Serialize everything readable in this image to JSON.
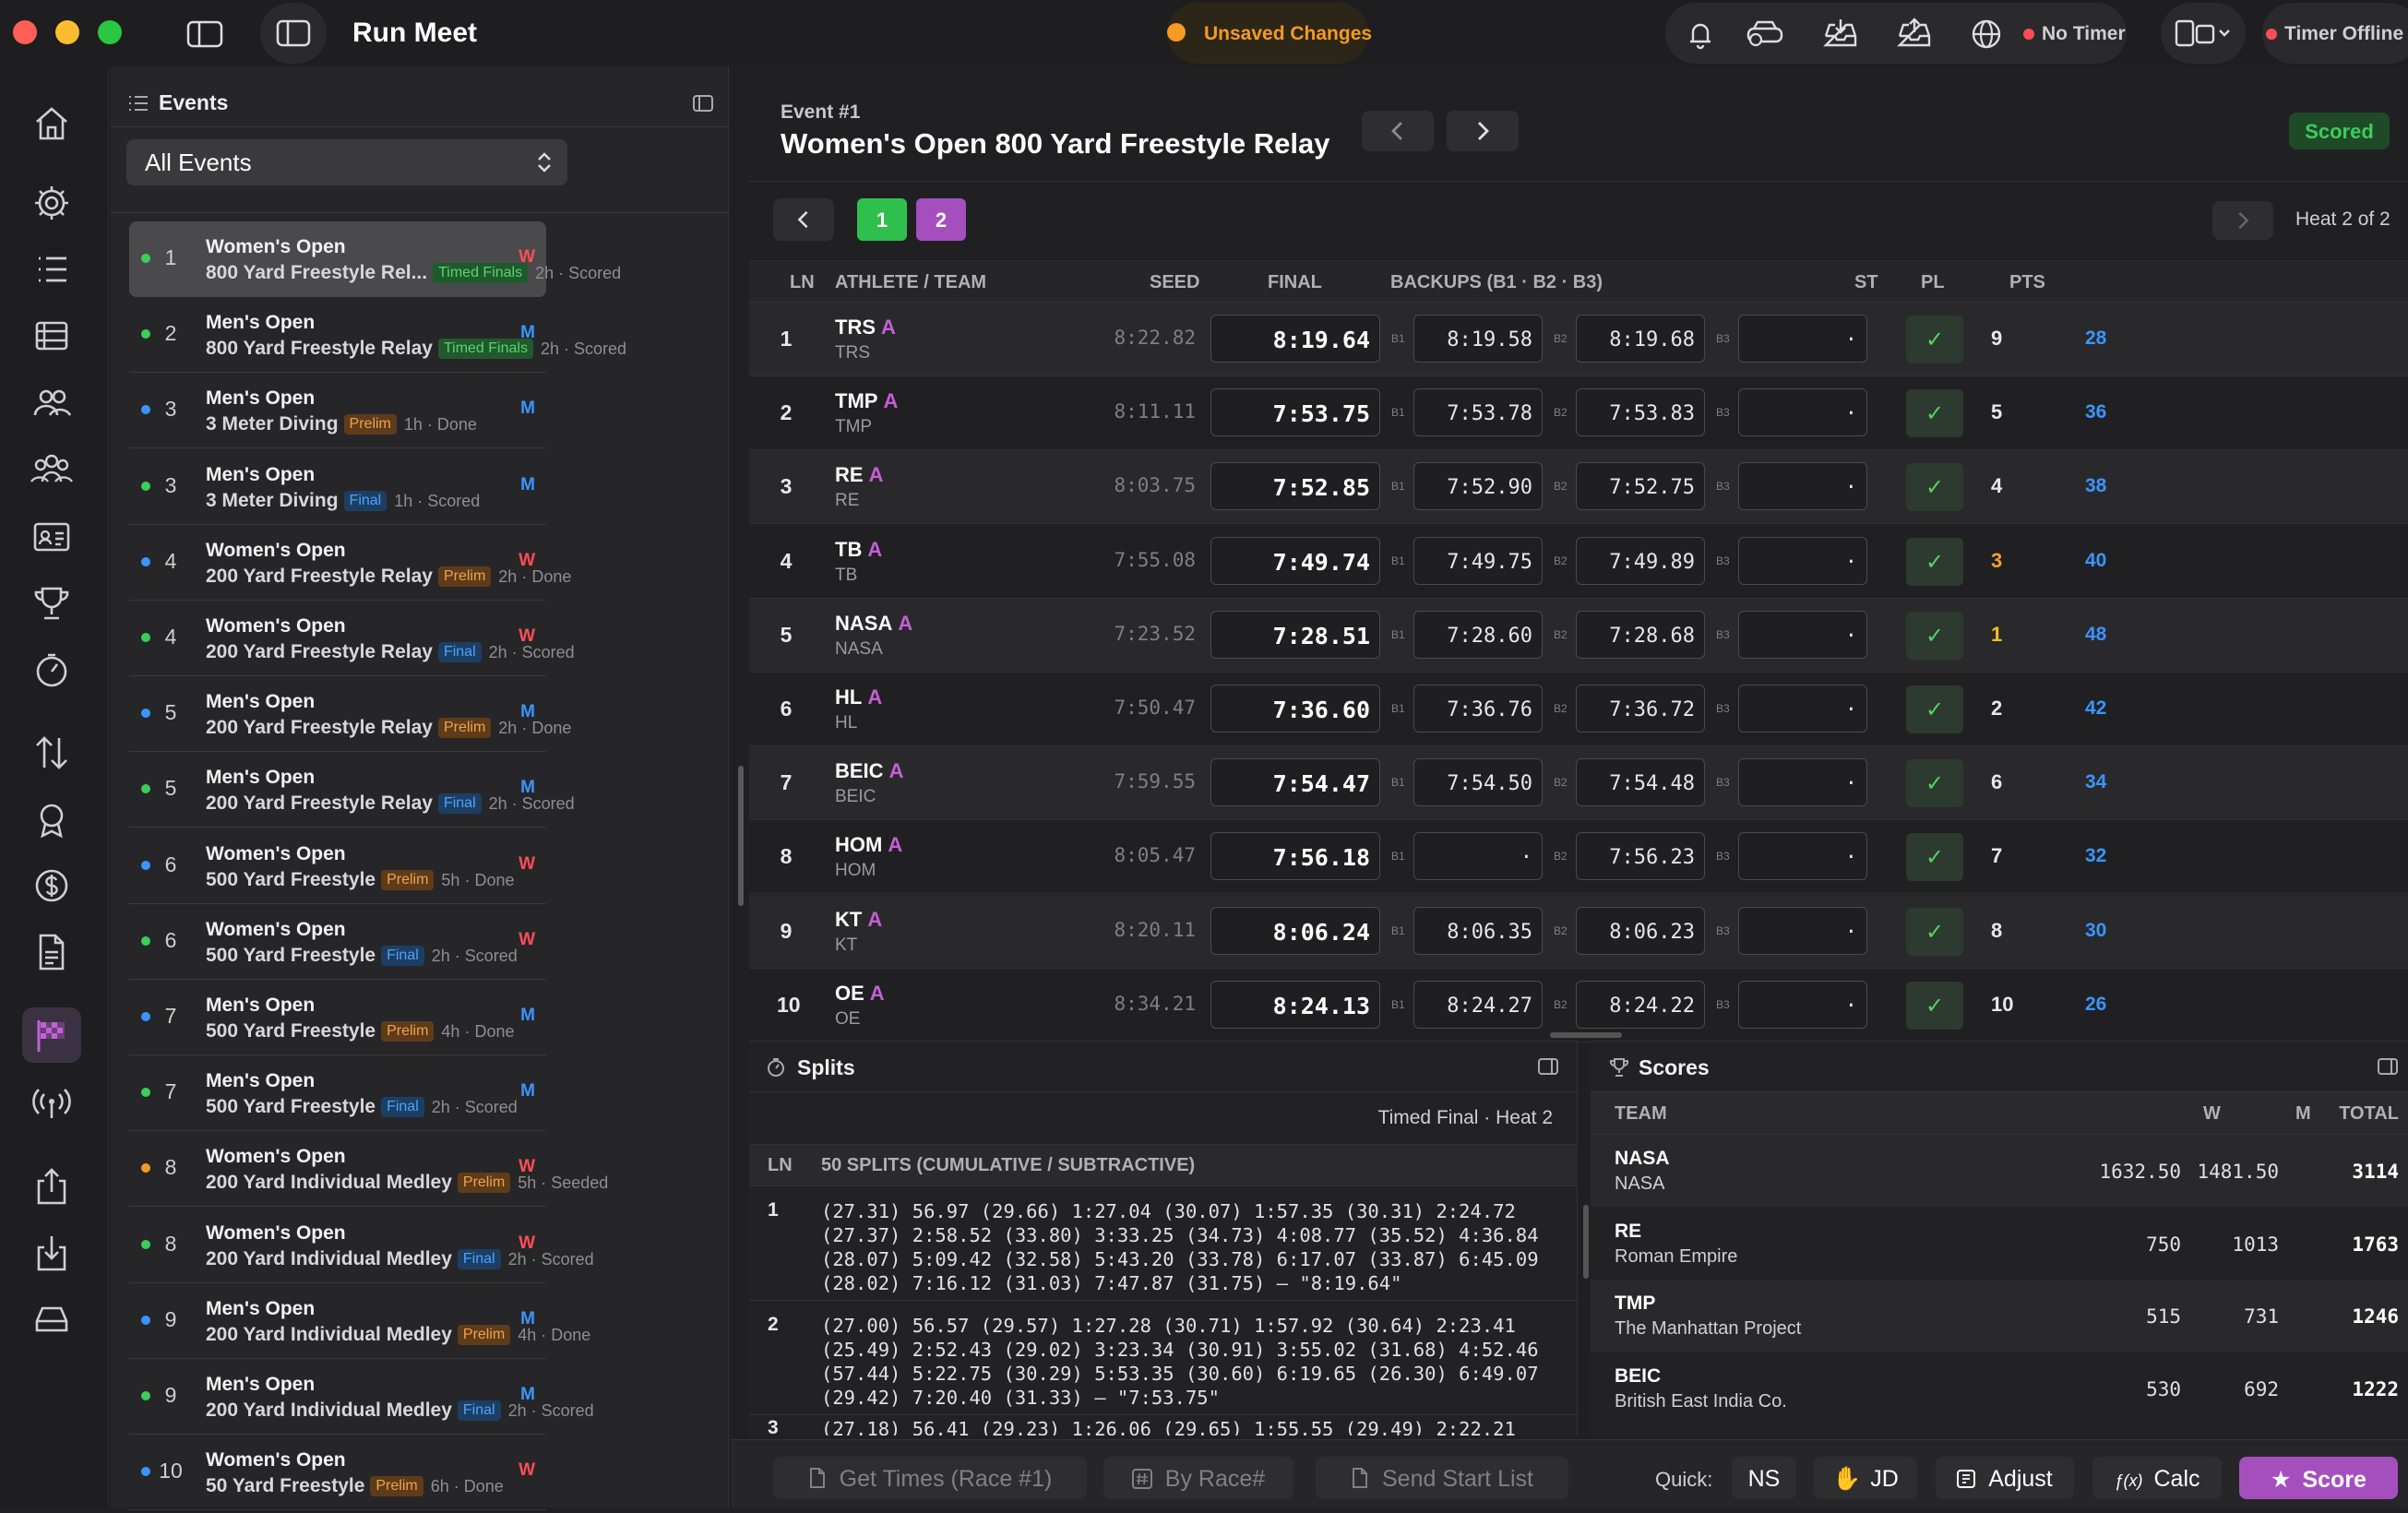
{
  "app": {
    "title": "Run Meet",
    "unsaved": "Unsaved Changes",
    "no_timer": "No Timer",
    "timer_offline": "Timer Offline"
  },
  "events_panel": {
    "title": "Events",
    "filter": "All Events",
    "items": [
      {
        "num": "1",
        "line1": "Women's Open",
        "line2": "800 Yard Freestyle Rel...",
        "badge": "Timed Finals",
        "badge_kind": "green",
        "meta": "2h · Scored",
        "gender": "W",
        "dot": "green",
        "selected": true
      },
      {
        "num": "2",
        "line1": "Men's Open",
        "line2": "800 Yard Freestyle Relay",
        "badge": "Timed Finals",
        "badge_kind": "green",
        "meta": "2h · Scored",
        "gender": "M",
        "dot": "green"
      },
      {
        "num": "3",
        "line1": "Men's Open",
        "line2": "3 Meter Diving",
        "badge": "Prelim",
        "badge_kind": "orange",
        "meta": "1h · Done",
        "gender": "M",
        "dot": "blue"
      },
      {
        "num": "3",
        "line1": "Men's Open",
        "line2": "3 Meter Diving",
        "badge": "Final",
        "badge_kind": "blue",
        "meta": "1h · Scored",
        "gender": "M",
        "dot": "green"
      },
      {
        "num": "4",
        "line1": "Women's Open",
        "line2": "200 Yard Freestyle Relay",
        "badge": "Prelim",
        "badge_kind": "orange",
        "meta": "2h · Done",
        "gender": "W",
        "dot": "blue"
      },
      {
        "num": "4",
        "line1": "Women's Open",
        "line2": "200 Yard Freestyle Relay",
        "badge": "Final",
        "badge_kind": "blue",
        "meta": "2h · Scored",
        "gender": "W",
        "dot": "green"
      },
      {
        "num": "5",
        "line1": "Men's Open",
        "line2": "200 Yard Freestyle Relay",
        "badge": "Prelim",
        "badge_kind": "orange",
        "meta": "2h · Done",
        "gender": "M",
        "dot": "blue"
      },
      {
        "num": "5",
        "line1": "Men's Open",
        "line2": "200 Yard Freestyle Relay",
        "badge": "Final",
        "badge_kind": "blue",
        "meta": "2h · Scored",
        "gender": "M",
        "dot": "green"
      },
      {
        "num": "6",
        "line1": "Women's Open",
        "line2": "500 Yard Freestyle",
        "badge": "Prelim",
        "badge_kind": "orange",
        "meta": "5h · Done",
        "gender": "W",
        "dot": "blue"
      },
      {
        "num": "6",
        "line1": "Women's Open",
        "line2": "500 Yard Freestyle",
        "badge": "Final",
        "badge_kind": "blue",
        "meta": "2h · Scored",
        "gender": "W",
        "dot": "green"
      },
      {
        "num": "7",
        "line1": "Men's Open",
        "line2": "500 Yard Freestyle",
        "badge": "Prelim",
        "badge_kind": "orange",
        "meta": "4h · Done",
        "gender": "M",
        "dot": "blue"
      },
      {
        "num": "7",
        "line1": "Men's Open",
        "line2": "500 Yard Freestyle",
        "badge": "Final",
        "badge_kind": "blue",
        "meta": "2h · Scored",
        "gender": "M",
        "dot": "green"
      },
      {
        "num": "8",
        "line1": "Women's Open",
        "line2": "200 Yard Individual Medley",
        "badge": "Prelim",
        "badge_kind": "orange",
        "meta": "5h · Seeded",
        "gender": "W",
        "dot": "orange"
      },
      {
        "num": "8",
        "line1": "Women's Open",
        "line2": "200 Yard Individual Medley",
        "badge": "Final",
        "badge_kind": "blue",
        "meta": "2h · Scored",
        "gender": "W",
        "dot": "green"
      },
      {
        "num": "9",
        "line1": "Men's Open",
        "line2": "200 Yard Individual Medley",
        "badge": "Prelim",
        "badge_kind": "orange",
        "meta": "4h · Done",
        "gender": "M",
        "dot": "blue"
      },
      {
        "num": "9",
        "line1": "Men's Open",
        "line2": "200 Yard Individual Medley",
        "badge": "Final",
        "badge_kind": "blue",
        "meta": "2h · Scored",
        "gender": "M",
        "dot": "green"
      },
      {
        "num": "10",
        "line1": "Women's Open",
        "line2": "50 Yard Freestyle",
        "badge": "Prelim",
        "badge_kind": "orange",
        "meta": "6h · Done",
        "gender": "W",
        "dot": "blue"
      }
    ]
  },
  "event": {
    "number": "Event #1",
    "name": "Women's Open 800 Yard Freestyle Relay",
    "status": "Scored",
    "heats": [
      "1",
      "2"
    ],
    "heat_label": "Heat 2 of 2"
  },
  "results": {
    "headers": {
      "ln": "LN",
      "athlete": "ATHLETE / TEAM",
      "seed": "SEED",
      "final": "FINAL",
      "backups": "BACKUPS (B1 · B2 · B3)",
      "st": "ST",
      "pl": "PL",
      "pts": "PTS"
    },
    "backup_labels": [
      "B1",
      "B2",
      "B3"
    ],
    "rows": [
      {
        "ln": "1",
        "team": "TRS",
        "relay": "A",
        "sub": "TRS",
        "seed": "8:22.82",
        "final": "8:19.64",
        "b1": "8:19.58",
        "b2": "8:19.68",
        "b3": "·",
        "st": "✓",
        "pl": "9",
        "pts": "28"
      },
      {
        "ln": "2",
        "team": "TMP",
        "relay": "A",
        "sub": "TMP",
        "seed": "8:11.11",
        "final": "7:53.75",
        "b1": "7:53.78",
        "b2": "7:53.83",
        "b3": "·",
        "st": "✓",
        "pl": "5",
        "pts": "36"
      },
      {
        "ln": "3",
        "team": "RE",
        "relay": "A",
        "sub": "RE",
        "seed": "8:03.75",
        "final": "7:52.85",
        "b1": "7:52.90",
        "b2": "7:52.75",
        "b3": "·",
        "st": "✓",
        "pl": "4",
        "pts": "38"
      },
      {
        "ln": "4",
        "team": "TB",
        "relay": "A",
        "sub": "TB",
        "seed": "7:55.08",
        "final": "7:49.74",
        "b1": "7:49.75",
        "b2": "7:49.89",
        "b3": "·",
        "st": "✓",
        "pl": "3",
        "pts": "40",
        "pl_color": "#f0a030"
      },
      {
        "ln": "5",
        "team": "NASA",
        "relay": "A",
        "sub": "NASA",
        "seed": "7:23.52",
        "final": "7:28.51",
        "b1": "7:28.60",
        "b2": "7:28.68",
        "b3": "·",
        "st": "✓",
        "pl": "1",
        "pts": "48",
        "pl_color": "#f0c020"
      },
      {
        "ln": "6",
        "team": "HL",
        "relay": "A",
        "sub": "HL",
        "seed": "7:50.47",
        "final": "7:36.60",
        "b1": "7:36.76",
        "b2": "7:36.72",
        "b3": "·",
        "st": "✓",
        "pl": "2",
        "pts": "42"
      },
      {
        "ln": "7",
        "team": "BEIC",
        "relay": "A",
        "sub": "BEIC",
        "seed": "7:59.55",
        "final": "7:54.47",
        "b1": "7:54.50",
        "b2": "7:54.48",
        "b3": "·",
        "st": "✓",
        "pl": "6",
        "pts": "34"
      },
      {
        "ln": "8",
        "team": "HOM",
        "relay": "A",
        "sub": "HOM",
        "seed": "8:05.47",
        "final": "7:56.18",
        "b1": "·",
        "b2": "7:56.23",
        "b3": "·",
        "st": "✓",
        "pl": "7",
        "pts": "32"
      },
      {
        "ln": "9",
        "team": "KT",
        "relay": "A",
        "sub": "KT",
        "seed": "8:20.11",
        "final": "8:06.24",
        "b1": "8:06.35",
        "b2": "8:06.23",
        "b3": "·",
        "st": "✓",
        "pl": "8",
        "pts": "30"
      },
      {
        "ln": "10",
        "team": "OE",
        "relay": "A",
        "sub": "OE",
        "seed": "8:34.21",
        "final": "8:24.13",
        "b1": "8:24.27",
        "b2": "8:24.22",
        "b3": "·",
        "st": "✓",
        "pl": "10",
        "pts": "26"
      }
    ]
  },
  "splits": {
    "title": "Splits",
    "context": "Timed Final · Heat 2",
    "col_ln": "LN",
    "col_splits": "50 SPLITS (CUMULATIVE / SUBTRACTIVE)",
    "rows": [
      {
        "ln": "1",
        "text": "(27.31) 56.97 (29.66) 1:27.04 (30.07) 1:57.35 (30.31) 2:24.72\n(27.37) 2:58.52 (33.80) 3:33.25 (34.73) 4:08.77 (35.52) 4:36.84\n(28.07) 5:09.42 (32.58) 5:43.20 (33.78) 6:17.07 (33.87) 6:45.09\n(28.02) 7:16.12 (31.03) 7:47.87 (31.75) – \"8:19.64\""
      },
      {
        "ln": "2",
        "text": "(27.00) 56.57 (29.57) 1:27.28 (30.71) 1:57.92 (30.64) 2:23.41\n(25.49) 2:52.43 (29.02) 3:23.34 (30.91) 3:55.02 (31.68) 4:52.46\n(57.44) 5:22.75 (30.29) 5:53.35 (30.60) 6:19.65 (26.30) 6:49.07\n(29.42) 7:20.40 (31.33) – \"7:53.75\""
      },
      {
        "ln": "3",
        "text": "(27.18) 56.41 (29.23) 1:26.06 (29.65) 1:55.55 (29.49) 2:22.21"
      }
    ]
  },
  "scores": {
    "title": "Scores",
    "headers": {
      "team": "TEAM",
      "w": "W",
      "m": "M",
      "total": "TOTAL"
    },
    "rows": [
      {
        "abbr": "NASA",
        "name": "NASA",
        "w": "1632.50",
        "m": "1481.50",
        "total": "3114"
      },
      {
        "abbr": "RE",
        "name": "Roman Empire",
        "w": "750",
        "m": "1013",
        "total": "1763"
      },
      {
        "abbr": "TMP",
        "name": "The Manhattan Project",
        "w": "515",
        "m": "731",
        "total": "1246"
      },
      {
        "abbr": "BEIC",
        "name": "British East India Co.",
        "w": "530",
        "m": "692",
        "total": "1222"
      }
    ]
  },
  "footer": {
    "get_times": "Get Times (Race #1)",
    "by_race": "By Race#",
    "send_start": "Send Start List",
    "quick": "Quick:",
    "ns": "NS",
    "jd": "JD",
    "adjust": "Adjust",
    "calc": "Calc",
    "score": "Score"
  },
  "colors": {
    "accent": "#c45fd6",
    "green": "#3ccd5d",
    "blue": "#3a95ff",
    "orange": "#f0a24c",
    "red": "#ff4d55"
  }
}
